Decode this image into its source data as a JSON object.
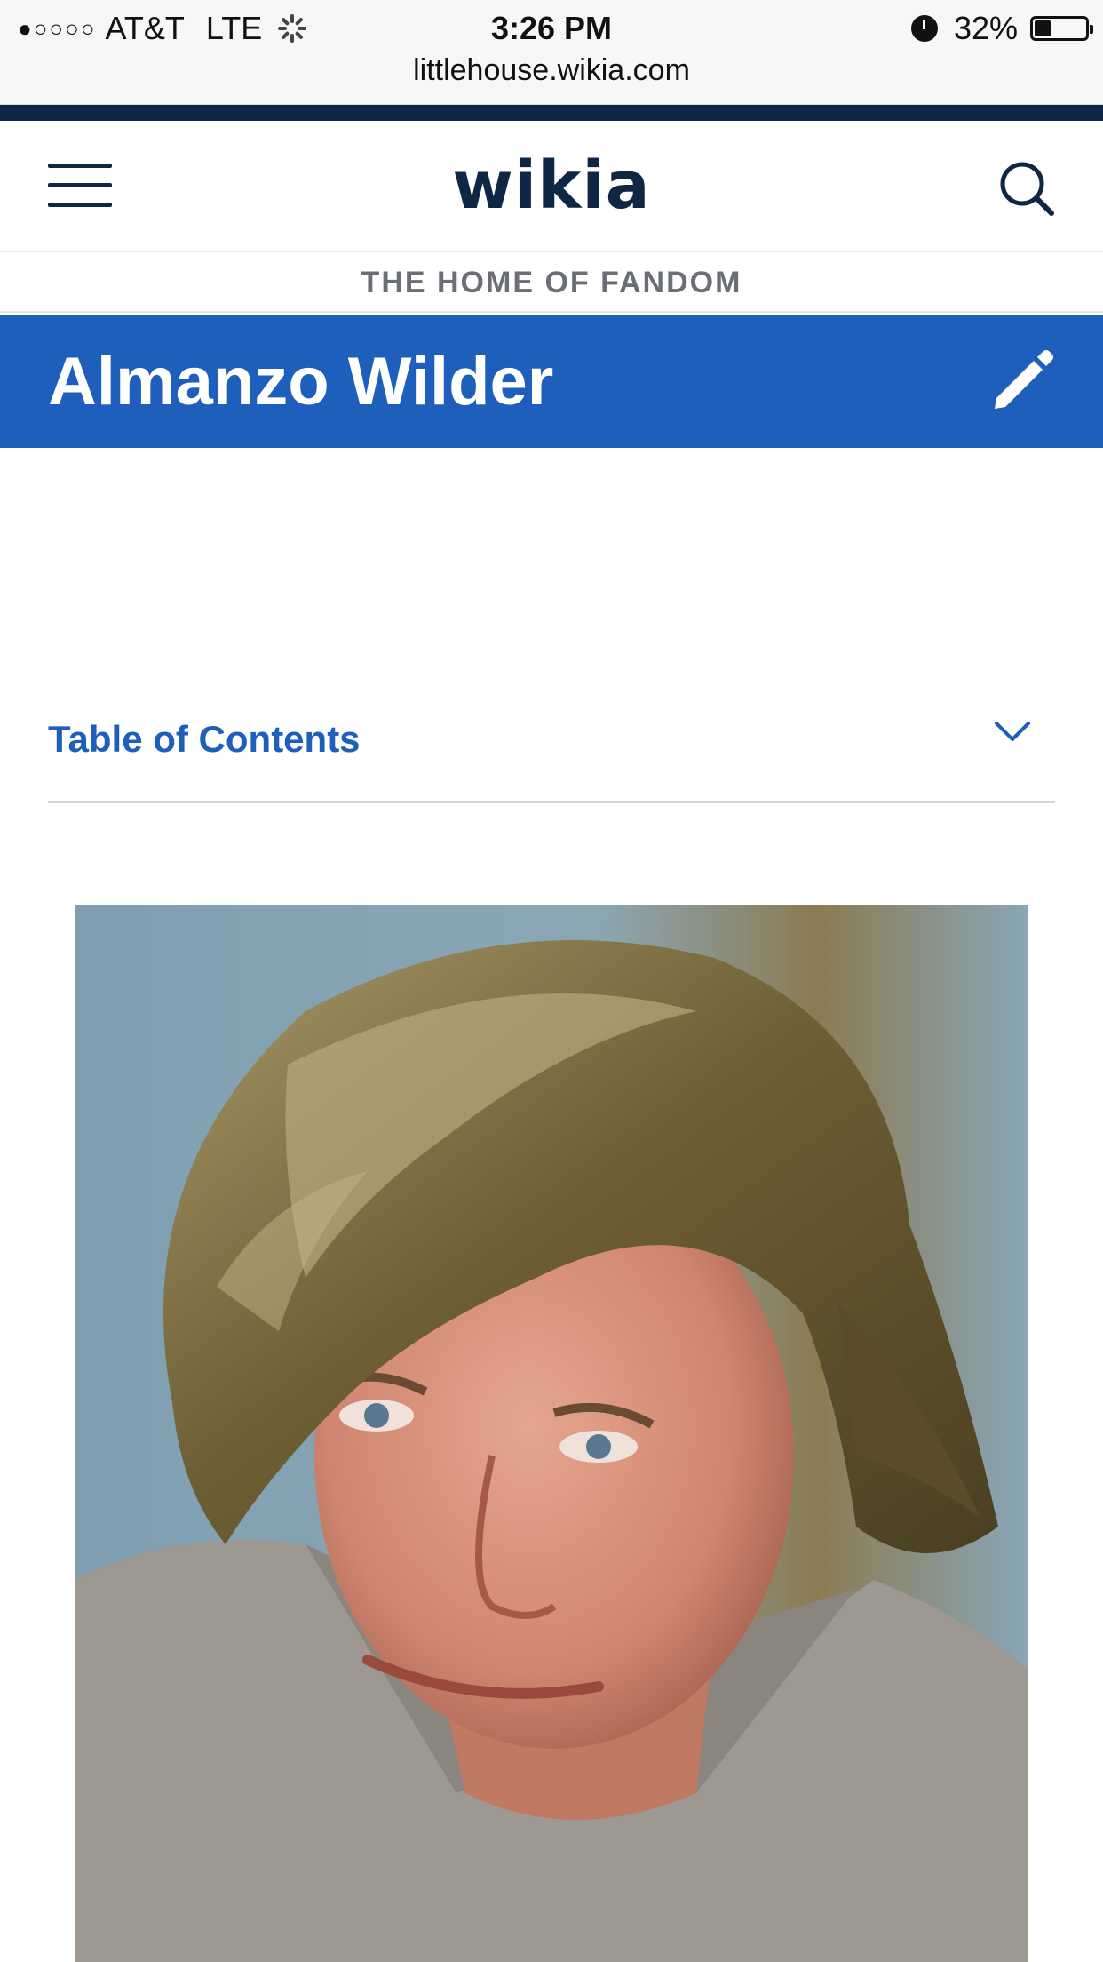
{
  "status_bar": {
    "signal": "●○○○○",
    "carrier": "AT&T",
    "network": "LTE",
    "time": "3:26 PM",
    "battery": "32%",
    "battery_level": 0.32,
    "url": "littlehouse.wikia.com"
  },
  "header": {
    "logo": "wikia",
    "tagline": "THE HOME OF FANDOM"
  },
  "article": {
    "title": "Almanzo Wilder",
    "toc_label": "Table of Contents"
  },
  "icons": {
    "menu": "hamburger-menu-icon",
    "search": "search-icon",
    "edit": "pencil-icon",
    "expand": "chevron-down-icon",
    "alarm": "alarm-clock-icon",
    "loading": "spinner-icon"
  },
  "colors": {
    "navy": "#0f2744",
    "brand_blue": "#1d5fbb",
    "tagline_gray": "#6b6f75"
  }
}
